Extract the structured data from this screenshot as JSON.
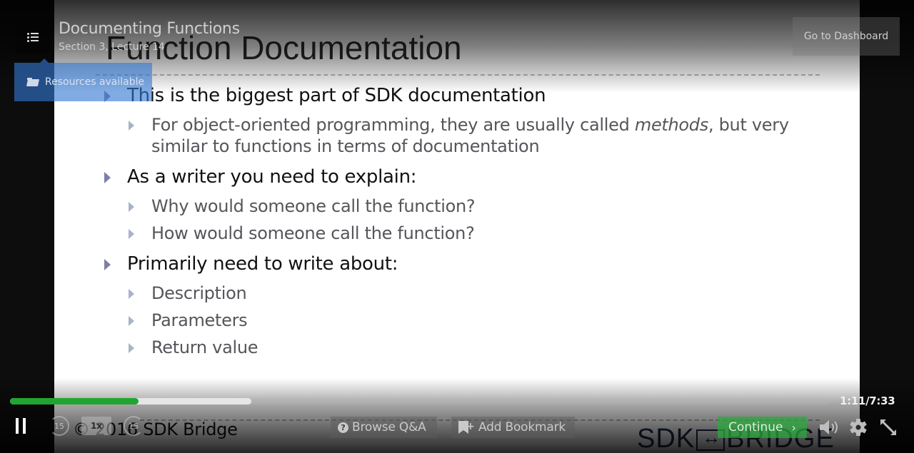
{
  "header": {
    "lecture_title": "Documenting Functions",
    "lecture_subtitle": "Section 3, Lecture 14",
    "resources_label": "Resources available",
    "dashboard_label": "Go to Dashboard",
    "icons": {
      "sidebar_toggle": "list-icon",
      "resources": "folder-open-icon"
    }
  },
  "slide": {
    "title": "Function Documentation",
    "bullets": [
      {
        "text": "This is the biggest part of SDK documentation",
        "children": [
          {
            "text_before": "For object-oriented programming, they are usually called ",
            "text_italic": "methods",
            "text_after": ", but very similar to functions in terms of documentation"
          }
        ]
      },
      {
        "text": "As a writer you need to explain:",
        "children": [
          {
            "text": "Why would someone call the function?"
          },
          {
            "text": "How would someone call the function?"
          }
        ]
      },
      {
        "text": "Primarily need to write about:",
        "children": [
          {
            "text": "Description"
          },
          {
            "text": "Parameters"
          },
          {
            "text": "Return value"
          }
        ]
      }
    ],
    "footer": "© 2016 SDK Bridge",
    "logo_left": "SDK",
    "logo_right": "BRIDGE"
  },
  "player": {
    "current_time": "1:11",
    "duration": "7:33",
    "time_readout": "1:11/7:33",
    "progress_fraction": 0.157,
    "buffered_fraction": 0.295,
    "rewind_seconds": "15",
    "forward_seconds": "15",
    "speed_label": "1x",
    "browse_qa_label": "Browse Q&A",
    "add_bookmark_label": "Add Bookmark",
    "continue_label": "Continue",
    "continue_chevron": "›",
    "bookmark_plus": "+",
    "qmark": "?",
    "icons": {
      "play_state": "pause-icon",
      "rewind": "rewind-15-icon",
      "forward": "forward-15-icon",
      "volume": "volume-icon",
      "settings": "gear-icon",
      "fullscreen": "expand-icon"
    },
    "colors": {
      "progress": "#21a531",
      "buffer": "#e6e6e6",
      "continue": "#28aa3c",
      "resources": "#3478d2"
    }
  }
}
